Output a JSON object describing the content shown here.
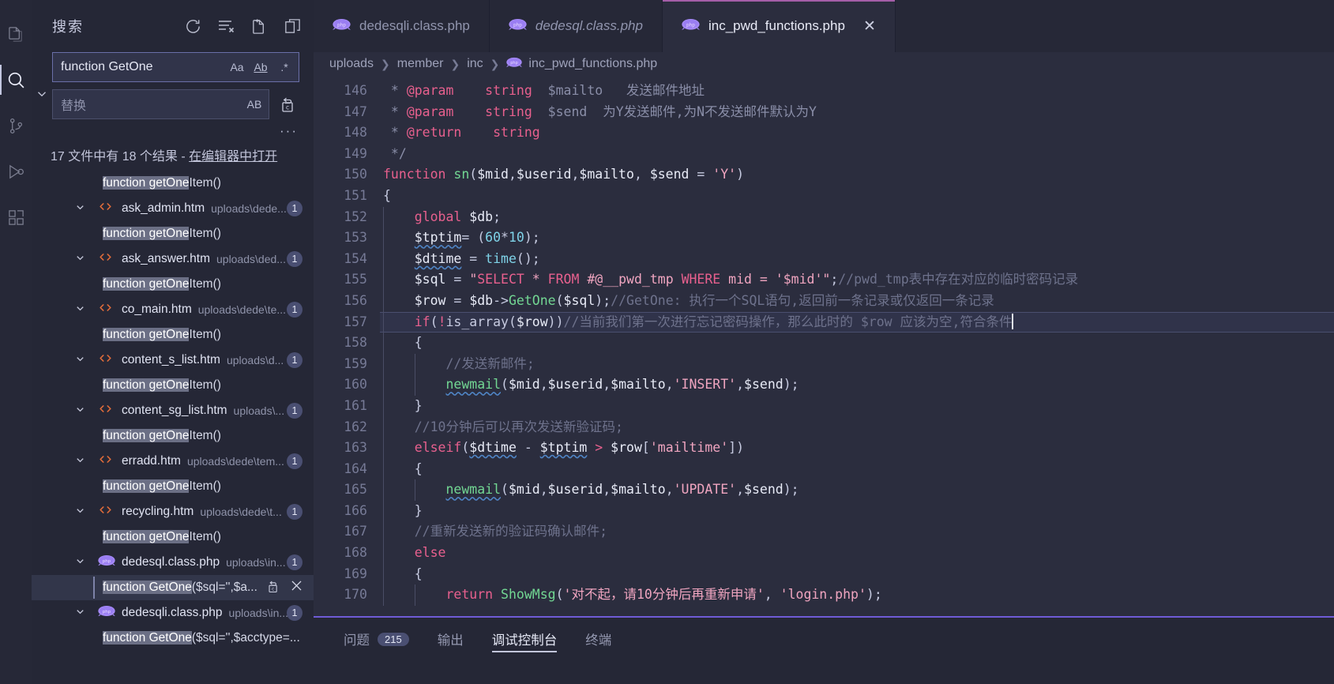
{
  "activity_bar": {
    "items": [
      {
        "name": "explorer",
        "icon": "files-icon",
        "active": false
      },
      {
        "name": "search",
        "icon": "search-icon",
        "active": true
      },
      {
        "name": "source-control",
        "icon": "source-control-icon",
        "active": false
      },
      {
        "name": "run-debug",
        "icon": "run-debug-icon",
        "active": false
      },
      {
        "name": "extensions",
        "icon": "extensions-icon",
        "active": false
      }
    ]
  },
  "sidebar": {
    "title": "搜索",
    "actions": [
      {
        "name": "refresh",
        "icon": "refresh-icon",
        "glyph": "↻"
      },
      {
        "name": "clear-search-results",
        "icon": "clear-all-icon",
        "glyph": "≡x"
      },
      {
        "name": "open-new-search-editor",
        "icon": "new-search-editor-icon",
        "glyph": "new-file"
      },
      {
        "name": "view-as-tree",
        "icon": "collapse-icon",
        "glyph": "panes"
      }
    ],
    "search": {
      "value": "function GetOne",
      "toggle_replace_icon": "chevron-down-icon",
      "options": [
        {
          "name": "match-case",
          "label": "Aa"
        },
        {
          "name": "match-whole-word",
          "label": "Ab"
        },
        {
          "name": "use-regex",
          "label": ".*"
        }
      ]
    },
    "replace": {
      "placeholder": "替换",
      "options": [
        {
          "name": "preserve-case",
          "label": "AB"
        }
      ],
      "replace_all_icon": "replace-all-icon"
    },
    "more_actions": "···",
    "summary": {
      "prefix": "17 文件中有 18 个结果 - ",
      "link": "在编辑器中打开"
    },
    "results": [
      {
        "type": "match",
        "match_prefix": "function getOne",
        "match_highlight": "Item()",
        "selected": false
      },
      {
        "type": "file",
        "icon": "html-icon",
        "name": "ask_admin.htm",
        "path": "uploads\\dede...",
        "count": "1",
        "expanded": true
      },
      {
        "type": "match",
        "match_prefix": "function getOne",
        "match_highlight": "Item()",
        "selected": false
      },
      {
        "type": "file",
        "icon": "html-icon",
        "name": "ask_answer.htm",
        "path": "uploads\\ded...",
        "count": "1",
        "expanded": true
      },
      {
        "type": "match",
        "match_prefix": "function getOne",
        "match_highlight": "Item()",
        "selected": false
      },
      {
        "type": "file",
        "icon": "html-icon",
        "name": "co_main.htm",
        "path": "uploads\\dede\\te...",
        "count": "1",
        "expanded": true
      },
      {
        "type": "match",
        "match_prefix": "function getOne",
        "match_highlight": "Item()",
        "selected": false
      },
      {
        "type": "file",
        "icon": "html-icon",
        "name": "content_s_list.htm",
        "path": "uploads\\d...",
        "count": "1",
        "expanded": true
      },
      {
        "type": "match",
        "match_prefix": "function getOne",
        "match_highlight": "Item()",
        "selected": false
      },
      {
        "type": "file",
        "icon": "html-icon",
        "name": "content_sg_list.htm",
        "path": "uploads\\...",
        "count": "1",
        "expanded": true
      },
      {
        "type": "match",
        "match_prefix": "function getOne",
        "match_highlight": "Item()",
        "selected": false
      },
      {
        "type": "file",
        "icon": "html-icon",
        "name": "erradd.htm",
        "path": "uploads\\dede\\tem...",
        "count": "1",
        "expanded": true
      },
      {
        "type": "match",
        "match_prefix": "function getOne",
        "match_highlight": "Item()",
        "selected": false
      },
      {
        "type": "file",
        "icon": "html-icon",
        "name": "recycling.htm",
        "path": "uploads\\dede\\t...",
        "count": "1",
        "expanded": true
      },
      {
        "type": "match",
        "match_prefix": "function getOne",
        "match_highlight": "Item()",
        "selected": false
      },
      {
        "type": "file",
        "icon": "php-icon",
        "name": "dedesql.class.php",
        "path": "uploads\\in...",
        "count": "1",
        "expanded": true
      },
      {
        "type": "match",
        "match_prefix": "function GetOne",
        "match_highlight": "($sql='',$a...",
        "selected": true,
        "actions": [
          {
            "name": "replace-match",
            "icon": "replace-icon"
          },
          {
            "name": "dismiss-match",
            "icon": "close-icon"
          }
        ]
      },
      {
        "type": "file",
        "icon": "php-icon",
        "name": "dedesqli.class.php",
        "path": "uploads\\in...",
        "count": "1",
        "expanded": true
      },
      {
        "type": "match",
        "match_prefix": "function GetOne",
        "match_highlight": "($sql='',$acctype=...",
        "selected": false
      }
    ]
  },
  "editor": {
    "tabs": [
      {
        "label": "dedesqli.class.php",
        "icon": "php-icon",
        "active": false,
        "preview": false,
        "closable": false
      },
      {
        "label": "dedesql.class.php",
        "icon": "php-icon",
        "active": false,
        "preview": true,
        "closable": false
      },
      {
        "label": "inc_pwd_functions.php",
        "icon": "php-icon",
        "active": true,
        "preview": false,
        "closable": true,
        "close_glyph": "✕"
      }
    ],
    "breadcrumb": [
      {
        "label": "uploads",
        "icon": null
      },
      {
        "label": "member",
        "icon": null
      },
      {
        "label": "inc",
        "icon": null
      },
      {
        "label": "inc_pwd_functions.php",
        "icon": "php-icon"
      }
    ],
    "first_line_number": 146,
    "current_line": 157,
    "lines": [
      {
        "n": 146,
        "tokens": [
          {
            "t": " * ",
            "c": "dcmt"
          },
          {
            "t": "@param",
            "c": "tag"
          },
          {
            "t": "    ",
            "c": "dcmt"
          },
          {
            "t": "string",
            "c": "kw"
          },
          {
            "t": "  ",
            "c": "dcmt"
          },
          {
            "t": "$mailto",
            "c": "dcmt"
          },
          {
            "t": "   发送邮件地址",
            "c": "dcmt"
          }
        ]
      },
      {
        "n": 147,
        "tokens": [
          {
            "t": " * ",
            "c": "dcmt"
          },
          {
            "t": "@param",
            "c": "tag"
          },
          {
            "t": "    ",
            "c": "dcmt"
          },
          {
            "t": "string",
            "c": "kw"
          },
          {
            "t": "  ",
            "c": "dcmt"
          },
          {
            "t": "$send",
            "c": "dcmt"
          },
          {
            "t": "  为Y发送邮件,为N不发送邮件默认为Y",
            "c": "dcmt"
          }
        ]
      },
      {
        "n": 148,
        "tokens": [
          {
            "t": " * ",
            "c": "dcmt"
          },
          {
            "t": "@return",
            "c": "tag"
          },
          {
            "t": "    ",
            "c": "dcmt"
          },
          {
            "t": "string",
            "c": "kw"
          }
        ]
      },
      {
        "n": 149,
        "tokens": [
          {
            "t": " */",
            "c": "dcmt"
          }
        ]
      },
      {
        "n": 150,
        "tokens": [
          {
            "t": "function ",
            "c": "kw"
          },
          {
            "t": "sn",
            "c": "fn"
          },
          {
            "t": "(",
            "c": "plain"
          },
          {
            "t": "$mid",
            "c": "var"
          },
          {
            "t": ",",
            "c": "plain"
          },
          {
            "t": "$userid",
            "c": "var"
          },
          {
            "t": ",",
            "c": "plain"
          },
          {
            "t": "$mailto",
            "c": "var"
          },
          {
            "t": ", ",
            "c": "plain"
          },
          {
            "t": "$send",
            "c": "var"
          },
          {
            "t": " = ",
            "c": "plain"
          },
          {
            "t": "'Y'",
            "c": "sql"
          },
          {
            "t": ")",
            "c": "plain"
          }
        ]
      },
      {
        "n": 151,
        "tokens": [
          {
            "t": "{",
            "c": "plain"
          }
        ]
      },
      {
        "n": 152,
        "indent": 1,
        "tokens": [
          {
            "t": "    ",
            "c": "plain"
          },
          {
            "t": "global ",
            "c": "kw"
          },
          {
            "t": "$db",
            "c": "var"
          },
          {
            "t": ";",
            "c": "plain"
          }
        ]
      },
      {
        "n": 153,
        "indent": 1,
        "tokens": [
          {
            "t": "    ",
            "c": "plain"
          },
          {
            "t": "$tptim",
            "c": "var squig"
          },
          {
            "t": "= (",
            "c": "plain"
          },
          {
            "t": "60",
            "c": "num"
          },
          {
            "t": "*",
            "c": "plain"
          },
          {
            "t": "10",
            "c": "num"
          },
          {
            "t": ");",
            "c": "plain"
          }
        ]
      },
      {
        "n": 154,
        "indent": 1,
        "tokens": [
          {
            "t": "    ",
            "c": "plain"
          },
          {
            "t": "$dtime",
            "c": "var squig"
          },
          {
            "t": " = ",
            "c": "plain"
          },
          {
            "t": "time",
            "c": "num"
          },
          {
            "t": "();",
            "c": "plain"
          }
        ]
      },
      {
        "n": 155,
        "indent": 1,
        "tokens": [
          {
            "t": "    ",
            "c": "plain"
          },
          {
            "t": "$sql",
            "c": "var"
          },
          {
            "t": " = ",
            "c": "plain"
          },
          {
            "t": "\"",
            "c": "sql"
          },
          {
            "t": "SELECT",
            "c": "str"
          },
          {
            "t": " * ",
            "c": "sql"
          },
          {
            "t": "FROM",
            "c": "str"
          },
          {
            "t": " #@__pwd_tmp ",
            "c": "sql"
          },
          {
            "t": "WHERE",
            "c": "str"
          },
          {
            "t": " mid = '$mid'",
            "c": "sql"
          },
          {
            "t": "\"",
            "c": "sql"
          },
          {
            "t": ";",
            "c": "plain"
          },
          {
            "t": "//pwd_tmp表中存在对应的临时密码记录",
            "c": "cmt"
          }
        ]
      },
      {
        "n": 156,
        "indent": 1,
        "tokens": [
          {
            "t": "    ",
            "c": "plain"
          },
          {
            "t": "$row",
            "c": "var"
          },
          {
            "t": " = ",
            "c": "plain"
          },
          {
            "t": "$db",
            "c": "var"
          },
          {
            "t": "->",
            "c": "plain"
          },
          {
            "t": "GetOne",
            "c": "fn"
          },
          {
            "t": "(",
            "c": "plain"
          },
          {
            "t": "$sql",
            "c": "var"
          },
          {
            "t": ");",
            "c": "plain"
          },
          {
            "t": "//GetOne: 执行一个SQL语句,返回前一条记录或仅返回一条记录",
            "c": "cmt"
          }
        ]
      },
      {
        "n": 157,
        "indent": 1,
        "current": true,
        "tokens": [
          {
            "t": "    ",
            "c": "plain"
          },
          {
            "t": "if",
            "c": "kw"
          },
          {
            "t": "(",
            "c": "plain"
          },
          {
            "t": "!",
            "c": "kw"
          },
          {
            "t": "is_array",
            "c": "plain"
          },
          {
            "t": "(",
            "c": "plain"
          },
          {
            "t": "$row",
            "c": "var"
          },
          {
            "t": "))",
            "c": "plain"
          },
          {
            "t": "//当前我们第一次进行忘记密码操作，那么此时的 $row 应该为空,符合条件",
            "c": "cmt"
          }
        ]
      },
      {
        "n": 158,
        "indent": 1,
        "tokens": [
          {
            "t": "    {",
            "c": "plain"
          }
        ]
      },
      {
        "n": 159,
        "indent": 2,
        "tokens": [
          {
            "t": "        ",
            "c": "plain"
          },
          {
            "t": "//发送新邮件;",
            "c": "cmt"
          }
        ]
      },
      {
        "n": 160,
        "indent": 2,
        "tokens": [
          {
            "t": "        ",
            "c": "plain"
          },
          {
            "t": "newmail",
            "c": "fn squig"
          },
          {
            "t": "(",
            "c": "plain"
          },
          {
            "t": "$mid",
            "c": "var"
          },
          {
            "t": ",",
            "c": "plain"
          },
          {
            "t": "$userid",
            "c": "var"
          },
          {
            "t": ",",
            "c": "plain"
          },
          {
            "t": "$mailto",
            "c": "var"
          },
          {
            "t": ",",
            "c": "plain"
          },
          {
            "t": "'INSERT'",
            "c": "sql"
          },
          {
            "t": ",",
            "c": "plain"
          },
          {
            "t": "$send",
            "c": "var"
          },
          {
            "t": ");",
            "c": "plain"
          }
        ]
      },
      {
        "n": 161,
        "indent": 1,
        "tokens": [
          {
            "t": "    }",
            "c": "plain"
          }
        ]
      },
      {
        "n": 162,
        "indent": 1,
        "tokens": [
          {
            "t": "    ",
            "c": "plain"
          },
          {
            "t": "//10分钟后可以再次发送新验证码;",
            "c": "cmt"
          }
        ]
      },
      {
        "n": 163,
        "indent": 1,
        "tokens": [
          {
            "t": "    ",
            "c": "plain"
          },
          {
            "t": "elseif",
            "c": "kw"
          },
          {
            "t": "(",
            "c": "plain"
          },
          {
            "t": "$dtime",
            "c": "var squig"
          },
          {
            "t": " - ",
            "c": "plain"
          },
          {
            "t": "$tptim",
            "c": "var squig"
          },
          {
            "t": " > ",
            "c": "kw"
          },
          {
            "t": "$row",
            "c": "var"
          },
          {
            "t": "[",
            "c": "plain"
          },
          {
            "t": "'mailtime'",
            "c": "sql"
          },
          {
            "t": "])",
            "c": "plain"
          }
        ]
      },
      {
        "n": 164,
        "indent": 1,
        "tokens": [
          {
            "t": "    {",
            "c": "plain"
          }
        ]
      },
      {
        "n": 165,
        "indent": 2,
        "tokens": [
          {
            "t": "        ",
            "c": "plain"
          },
          {
            "t": "newmail",
            "c": "fn squig"
          },
          {
            "t": "(",
            "c": "plain"
          },
          {
            "t": "$mid",
            "c": "var"
          },
          {
            "t": ",",
            "c": "plain"
          },
          {
            "t": "$userid",
            "c": "var"
          },
          {
            "t": ",",
            "c": "plain"
          },
          {
            "t": "$mailto",
            "c": "var"
          },
          {
            "t": ",",
            "c": "plain"
          },
          {
            "t": "'UPDATE'",
            "c": "sql"
          },
          {
            "t": ",",
            "c": "plain"
          },
          {
            "t": "$send",
            "c": "var"
          },
          {
            "t": ");",
            "c": "plain"
          }
        ]
      },
      {
        "n": 166,
        "indent": 1,
        "tokens": [
          {
            "t": "    }",
            "c": "plain"
          }
        ]
      },
      {
        "n": 167,
        "indent": 1,
        "tokens": [
          {
            "t": "    ",
            "c": "plain"
          },
          {
            "t": "//重新发送新的验证码确认邮件;",
            "c": "cmt"
          }
        ]
      },
      {
        "n": 168,
        "indent": 1,
        "tokens": [
          {
            "t": "    ",
            "c": "plain"
          },
          {
            "t": "else",
            "c": "kw"
          }
        ]
      },
      {
        "n": 169,
        "indent": 1,
        "tokens": [
          {
            "t": "    {",
            "c": "plain"
          }
        ]
      },
      {
        "n": 170,
        "indent": 2,
        "tokens": [
          {
            "t": "        ",
            "c": "plain"
          },
          {
            "t": "return ",
            "c": "kw"
          },
          {
            "t": "ShowMsg",
            "c": "fn"
          },
          {
            "t": "(",
            "c": "plain"
          },
          {
            "t": "'对不起，请10分钟后再重新申请'",
            "c": "sql"
          },
          {
            "t": ", ",
            "c": "plain"
          },
          {
            "t": "'login.php'",
            "c": "sql"
          },
          {
            "t": ");",
            "c": "plain"
          }
        ]
      }
    ]
  },
  "panel": {
    "tabs": [
      {
        "label": "问题",
        "badge": "215",
        "active": false
      },
      {
        "label": "输出",
        "badge": null,
        "active": false
      },
      {
        "label": "调试控制台",
        "badge": null,
        "active": true
      },
      {
        "label": "终端",
        "badge": null,
        "active": false
      }
    ]
  },
  "colors": {
    "accent": "#6f5bd6",
    "tab_active_border": "#a45ea8",
    "background": "#2b2d3e",
    "sidebar_bg": "#252736",
    "activity_bg": "#262837"
  }
}
